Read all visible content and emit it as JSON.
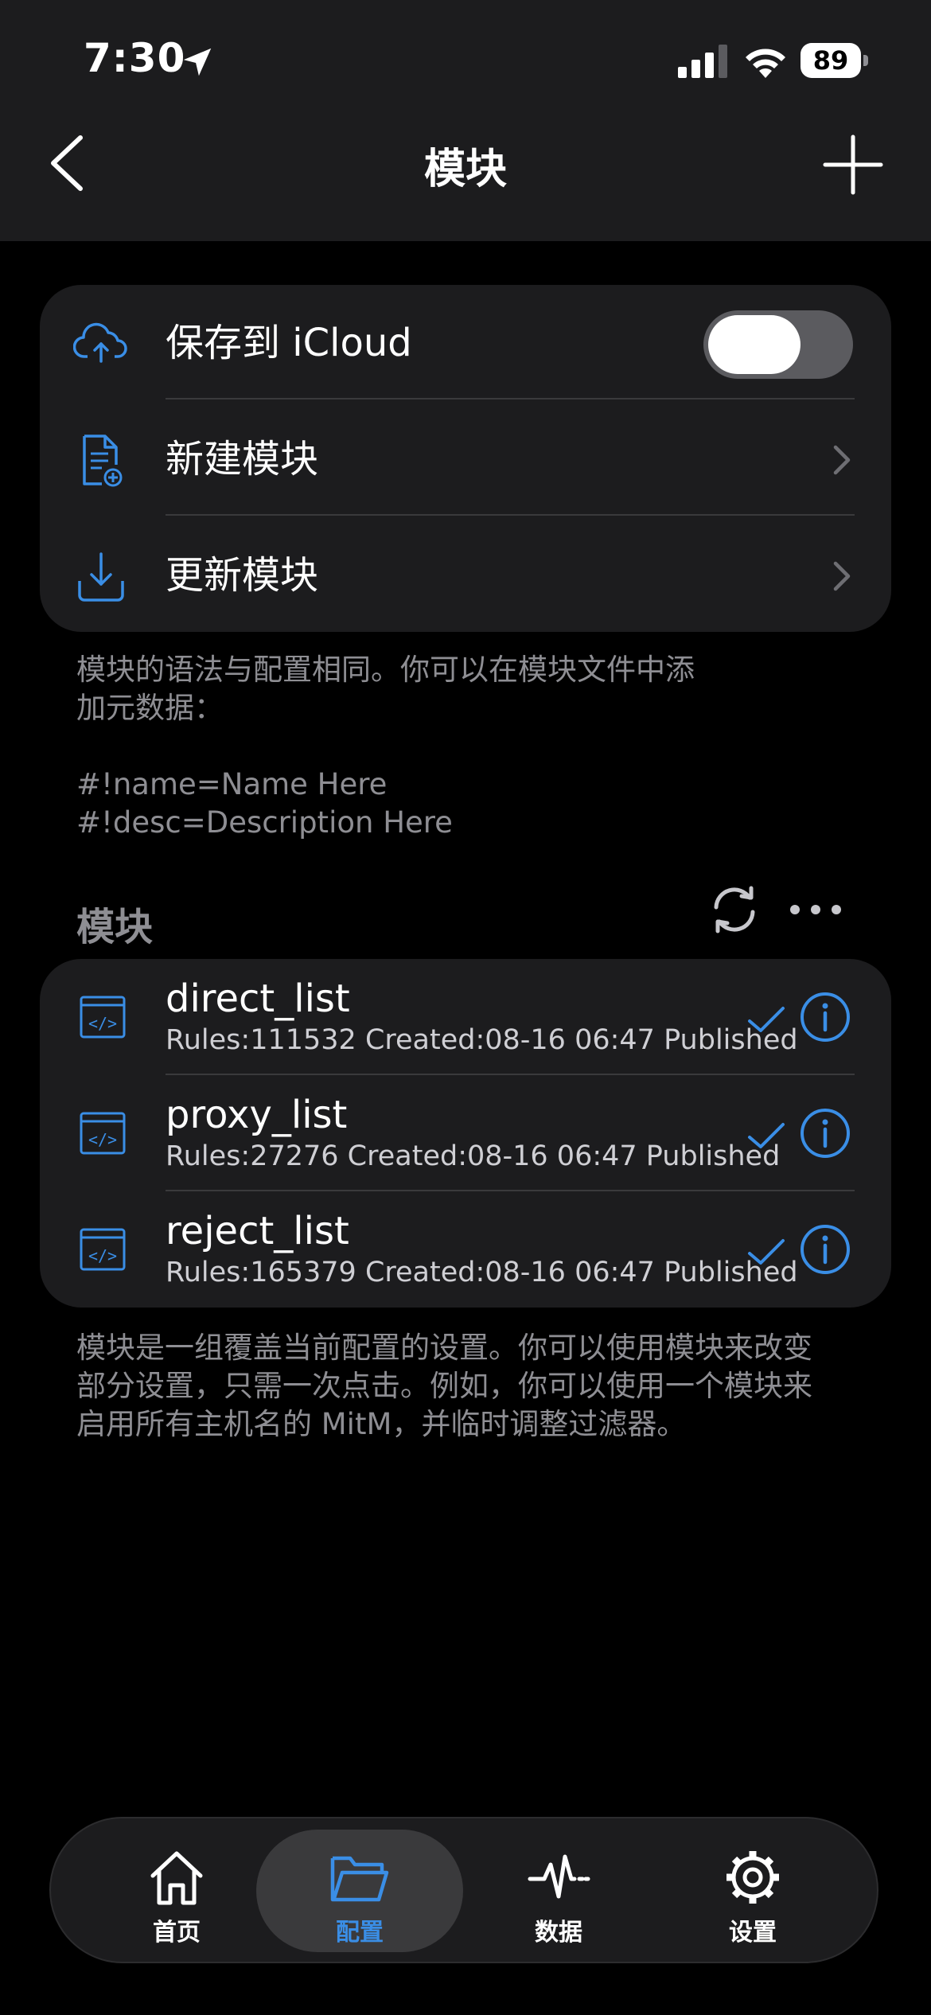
{
  "status_bar": {
    "time": "7:30",
    "battery": "89"
  },
  "nav": {
    "title": "模块"
  },
  "settings_card": {
    "icloud_label": "保存到 iCloud",
    "icloud_enabled": true,
    "new_module_label": "新建模块",
    "update_module_label": "更新模块"
  },
  "info_note": {
    "line1": "模块的语法与配置相同。你可以在模块文件中添",
    "line2": "加元数据：",
    "line3": "#!name=Name Here",
    "line4": "#!desc=Description Here"
  },
  "modules_section": {
    "title": "模块",
    "items": [
      {
        "name": "direct_list",
        "meta": "Rules:111532 Created:08-16 06:47 Published",
        "enabled": true
      },
      {
        "name": "proxy_list",
        "meta": "Rules:27276 Created:08-16 06:47 Published",
        "enabled": true
      },
      {
        "name": "reject_list",
        "meta": "Rules:165379 Created:08-16 06:47 Published",
        "enabled": true
      }
    ]
  },
  "footer_note": {
    "line1": "模块是一组覆盖当前配置的设置。你可以使用模块来改变",
    "line2": "部分设置，只需一次点击。例如，你可以使用一个模块来",
    "line3": "启用所有主机名的 MitM，并临时调整过滤器。"
  },
  "tabbar": {
    "tabs": [
      {
        "label": "首页",
        "icon": "home-icon"
      },
      {
        "label": "配置",
        "icon": "folder-icon",
        "active": true
      },
      {
        "label": "数据",
        "icon": "activity-icon"
      },
      {
        "label": "设置",
        "icon": "gear-icon"
      }
    ]
  },
  "colors": {
    "accent": "#3a8ee6",
    "background": "#000000",
    "card": "#1c1c1e"
  }
}
